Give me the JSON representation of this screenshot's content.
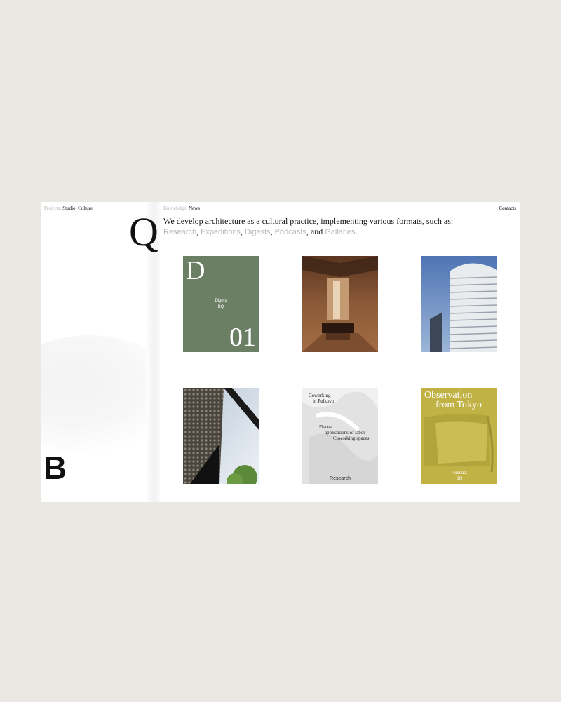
{
  "nav": {
    "left": {
      "muted": "Projects",
      "sep": ": ",
      "link1": "Studio",
      "comma": ", ",
      "link2": "Culture"
    },
    "mid": {
      "muted": "Knowledge",
      "sep": ": ",
      "link": "News"
    },
    "right": {
      "link": "Contacts"
    }
  },
  "logos": {
    "q": "Q",
    "b": "B"
  },
  "intro": {
    "lead": "We develop architecture as a cultural practice, implementing various formats, such as:",
    "formats": [
      "Research",
      "Expeditions",
      "Digests",
      "Podcasts",
      "Galleries"
    ],
    "and": "and",
    "end": "."
  },
  "cards": {
    "digests": {
      "letter": "D",
      "title": "Digets",
      "subtitle": "BQ",
      "number": "01",
      "color": "#6b7f64"
    },
    "interior": {
      "color": "#7a4a2d"
    },
    "tower": {
      "color": "#6a8cc1"
    },
    "facade": {
      "color": "#3d3a34"
    },
    "research": {
      "title_line1": "Coworking",
      "title_line2": "in Pulkovo",
      "text_line1": "Places",
      "text_line2": "applications of labor",
      "text_line3": "Coworking spaces",
      "label": "Research"
    },
    "podcast": {
      "title_line1": "Observation",
      "title_line2": "from Tokyo",
      "label": "Podcast",
      "sublabel": "BQ",
      "color": "#c0b245"
    }
  },
  "colors": {
    "page_bg": "#ebe8e4",
    "muted": "#b5b5b5"
  }
}
